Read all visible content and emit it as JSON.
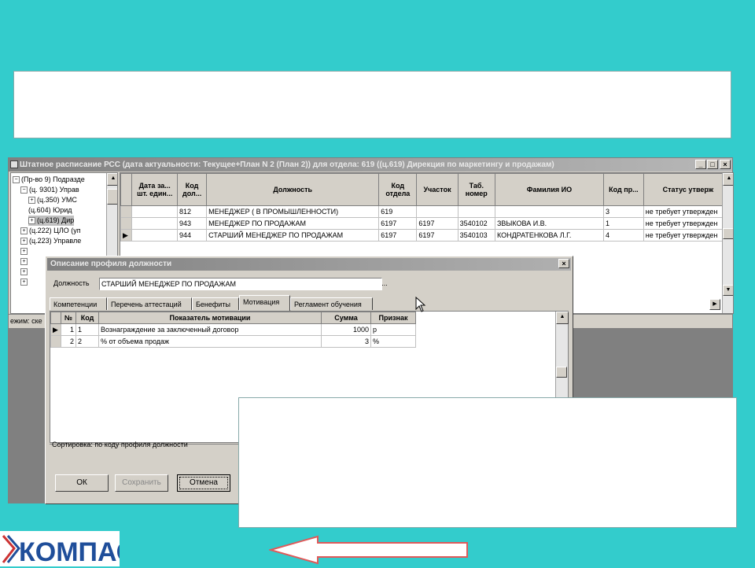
{
  "main_window": {
    "title": "Штатное расписание РСС (дата актуальности: Текущее+План N 2 (План 2)) для отдела: 619 ((ц.619) Дирекция по маркетингу и продажам)",
    "minimize": "_",
    "maximize": "□",
    "close": "×",
    "tree": [
      {
        "label": "(Пр-во 9) Подразде",
        "indent": 0,
        "toggle": "−"
      },
      {
        "label": "(ц. 9301) Управ",
        "indent": 1,
        "toggle": "−"
      },
      {
        "label": "(ц.350) УМС",
        "indent": 2,
        "toggle": "+"
      },
      {
        "label": "(ц.604) Юрид",
        "indent": 2,
        "toggle": ""
      },
      {
        "label": "(ц.619) Дир",
        "indent": 2,
        "toggle": "+"
      },
      {
        "label": "(ц.222) ЦЛО (уп",
        "indent": 1,
        "toggle": "+"
      },
      {
        "label": "(ц.223) Управле",
        "indent": 1,
        "toggle": "+"
      },
      {
        "label": "",
        "indent": 1,
        "toggle": "+"
      },
      {
        "label": "",
        "indent": 1,
        "toggle": "+"
      },
      {
        "label": "",
        "indent": 1,
        "toggle": "+"
      },
      {
        "label": "",
        "indent": 1,
        "toggle": "+"
      }
    ],
    "columns": [
      "",
      "Дата за... шт. един...",
      "Код дол...",
      "Должность",
      "Код отдела",
      "Участок",
      "Таб. номер",
      "Фамилия ИО",
      "Код пр...",
      "Статус утверж"
    ],
    "rows": [
      [
        "",
        "",
        "812",
        "МЕНЕДЖЕР ( В ПРОМЫШЛЕННОСТИ)",
        "619",
        "",
        "",
        "",
        "3",
        "не требует утвержден"
      ],
      [
        "",
        "",
        "943",
        "МЕНЕДЖЕР ПО ПРОДАЖАМ",
        "6197",
        "6197",
        "3540102",
        "ЗВЫКОВА И.В.",
        "1",
        "не требует утвержден"
      ],
      [
        "▶",
        "",
        "944",
        "СТАРШИЙ МЕНЕДЖЕР ПО ПРОДАЖАМ",
        "6197",
        "6197",
        "3540103",
        "КОНДРАТЕНКОВА Л.Г.",
        "4",
        "не требует утвержден"
      ]
    ],
    "status": "ежим: ске"
  },
  "dialog": {
    "title": "Описание профиля должности",
    "close": "×",
    "position_label": "Должность",
    "position_value": "СТАРШИЙ МЕНЕДЖЕР ПО ПРОДАЖАМ",
    "ellipsis": "...",
    "tabs": [
      "Компетенции",
      "Перечень аттестаций",
      "Бенефиты",
      "Мотивация",
      "Регламент обучения"
    ],
    "active_tab": "Мотивация",
    "columns": [
      "",
      "№",
      "Код",
      "Показатель мотивации",
      "Сумма",
      "Признак"
    ],
    "rows": [
      [
        "▶",
        "1",
        "1",
        "Вознаграждение за заключенный договор",
        "1000",
        "р"
      ],
      [
        "",
        "2",
        "2",
        "% от объема продаж",
        "3",
        "%"
      ]
    ],
    "sort_text": "Сортировка: по коду профиля должности",
    "buttons": {
      "ok": "ОК",
      "save": "Сохранить",
      "cancel": "Отмена"
    }
  },
  "logo": {
    "text": "КОМПАС"
  },
  "colors": {
    "background": "#33cccc",
    "logo_blue": "#1f4e9a",
    "arrow": "#e05a5a"
  }
}
